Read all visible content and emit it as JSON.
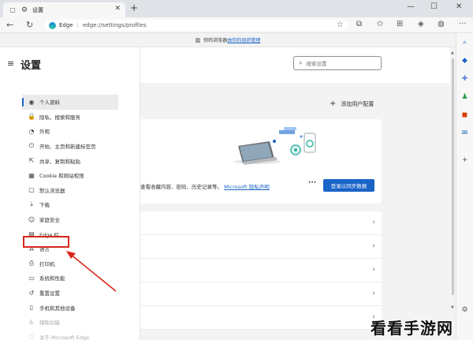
{
  "tab": {
    "title": "设置",
    "close": "✕"
  },
  "newtab": "+",
  "window": {
    "minimize": "—",
    "maximize": "☐",
    "close": "✕"
  },
  "address": {
    "brand": "Edge",
    "separator": "|",
    "path": "edge://settings/profiles"
  },
  "managed_banner": {
    "prefix": "你的浏览器",
    "link": "由你的组织管理"
  },
  "settings": {
    "title": "设置",
    "search_placeholder": "搜索设置"
  },
  "nav": [
    {
      "label": "个人资料",
      "icon": "profile-icon",
      "glyph": "◉",
      "active": true
    },
    {
      "label": "隐私、搜索和服务",
      "icon": "lock-icon",
      "glyph": "🔒"
    },
    {
      "label": "外观",
      "icon": "palette-icon",
      "glyph": "◔"
    },
    {
      "label": "开始、主页和新建标签页",
      "icon": "power-icon",
      "glyph": "⏻"
    },
    {
      "label": "共享、复制和粘贴",
      "icon": "share-icon",
      "glyph": "⇱"
    },
    {
      "label": "Cookie 和网站权限",
      "icon": "site-permissions-icon",
      "glyph": "▦"
    },
    {
      "label": "默认浏览器",
      "icon": "browser-icon",
      "glyph": "▢"
    },
    {
      "label": "下载",
      "icon": "download-icon",
      "glyph": "⤓"
    },
    {
      "label": "家庭安全",
      "icon": "family-icon",
      "glyph": "☺"
    },
    {
      "label": "Edge 栏",
      "icon": "edge-bar-icon",
      "glyph": "▤"
    },
    {
      "label": "语言",
      "icon": "language-icon",
      "glyph": "A"
    },
    {
      "label": "打印机",
      "icon": "printer-icon",
      "glyph": "⎙"
    },
    {
      "label": "系统和性能",
      "icon": "system-icon",
      "glyph": "▭"
    },
    {
      "label": "重置设置",
      "icon": "reset-icon",
      "glyph": "↺"
    },
    {
      "label": "手机和其他设备",
      "icon": "phone-icon",
      "glyph": "▯"
    },
    {
      "label": "辅助功能",
      "icon": "accessibility-icon",
      "glyph": "♿",
      "dim": true
    },
    {
      "label": "关于 Microsoft Edge",
      "icon": "edge-icon",
      "glyph": "◌",
      "dim": true
    }
  ],
  "profile": {
    "add_profile": "添加用户配置",
    "sync_text": "查看收藏内容、密码、历史记录等。",
    "privacy_link": "Microsoft 隐私声明",
    "more": "···",
    "sync_button": "登录以同步数据"
  },
  "watermark": "看看手游网",
  "colors": {
    "accent": "#1a64c8",
    "highlight": "#d9261c"
  }
}
